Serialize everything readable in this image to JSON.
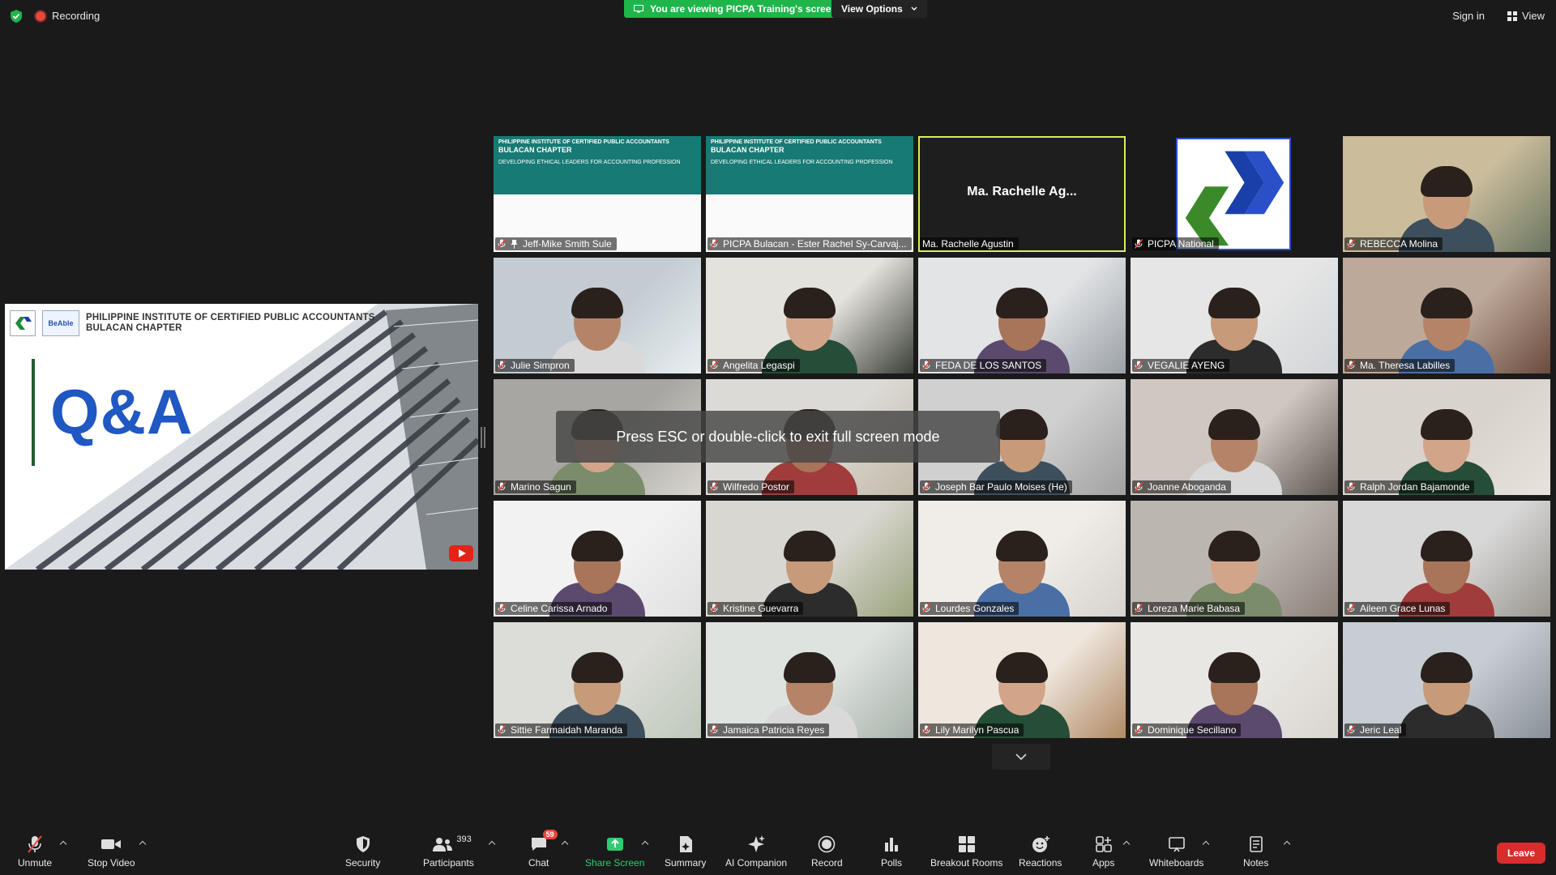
{
  "topbar": {
    "recording_label": "Recording",
    "viewing_banner": "You are viewing PICPA Training's screen",
    "view_options_label": "View Options",
    "sign_in_label": "Sign in",
    "view_label": "View"
  },
  "shared_screen": {
    "org_line1": "PHILIPPINE INSTITUTE OF CERTIFIED PUBLIC ACCOUNTANTS",
    "org_line2": "BULACAN CHAPTER",
    "logo_text": "BeAble",
    "heading": "Q&A"
  },
  "slide_tile_text": {
    "org_line1": "PHILIPPINE INSTITUTE OF CERTIFIED PUBLIC ACCOUNTANTS",
    "org_line2": "BULACAN CHAPTER",
    "topic": "DEVELOPING ETHICAL LEADERS FOR ACCOUNTING PROFESSION"
  },
  "participants": [
    {
      "name": "Jeff-Mike Smith Sule",
      "pinned": true,
      "muted": true,
      "style": "slide"
    },
    {
      "name": "PICPA Bulacan - Ester Rachel Sy-Carvaj...",
      "muted": true,
      "style": "slide"
    },
    {
      "name": "Ma. Rachelle Agustin",
      "display_name": "Ma. Rachelle Ag...",
      "muted": false,
      "style": "no-video",
      "active_speaker": true
    },
    {
      "name": "PICPA National",
      "muted": true,
      "style": "logo"
    },
    {
      "name": "REBECCA Molina",
      "muted": true,
      "style": "video"
    },
    {
      "name": "Julie Simpron",
      "muted": true,
      "style": "video"
    },
    {
      "name": "Angelita Legaspi",
      "muted": true,
      "style": "video"
    },
    {
      "name": "FEDA DE LOS SANTOS",
      "muted": true,
      "style": "video"
    },
    {
      "name": "VEGALIE AYENG",
      "muted": true,
      "style": "video"
    },
    {
      "name": "Ma. Theresa Labilles",
      "muted": true,
      "style": "video"
    },
    {
      "name": "Marino Sagun",
      "muted": true,
      "style": "video"
    },
    {
      "name": "Wilfredo Postor",
      "muted": true,
      "style": "video"
    },
    {
      "name": "Joseph Bar Paulo Moises (He)",
      "muted": true,
      "style": "video"
    },
    {
      "name": "Joanne Aboganda",
      "muted": true,
      "style": "video"
    },
    {
      "name": "Ralph Jordan Bajamonde",
      "muted": true,
      "style": "video"
    },
    {
      "name": "Celine Carissa Arnado",
      "muted": true,
      "style": "video"
    },
    {
      "name": "Kristine Guevarra",
      "muted": true,
      "style": "video"
    },
    {
      "name": "Lourdes Gonzales",
      "muted": true,
      "style": "video"
    },
    {
      "name": "Loreza Marie Babasa",
      "muted": true,
      "style": "video"
    },
    {
      "name": "Aileen Grace Lunas",
      "muted": true,
      "style": "video"
    },
    {
      "name": "Sittie Farmaidah Maranda",
      "muted": true,
      "style": "video"
    },
    {
      "name": "Jamaica Patricia Reyes",
      "muted": true,
      "style": "video"
    },
    {
      "name": "Lily Marilyn Pascua",
      "muted": true,
      "style": "video"
    },
    {
      "name": "Dominique Secillano",
      "muted": true,
      "style": "video"
    },
    {
      "name": "Jeric Leal",
      "muted": true,
      "style": "video"
    }
  ],
  "toast": "Press ESC or double-click to exit full screen mode",
  "toolbar": {
    "unmute": "Unmute",
    "stop_video": "Stop Video",
    "security": "Security",
    "participants": "Participants",
    "participant_count": "393",
    "chat": "Chat",
    "chat_badge": "59",
    "share_screen": "Share Screen",
    "summary": "Summary",
    "ai_companion": "AI Companion",
    "record": "Record",
    "polls": "Polls",
    "breakout_rooms": "Breakout Rooms",
    "reactions": "Reactions",
    "apps": "Apps",
    "whiteboards": "Whiteboards",
    "notes": "Notes",
    "leave": "Leave"
  },
  "colors": {
    "background": "#1a1a1a",
    "share_green": "#1fb54a",
    "leave_red": "#d92c2c",
    "active_speaker_border": "#d7ef5b",
    "qa_blue": "#1f57c3"
  }
}
